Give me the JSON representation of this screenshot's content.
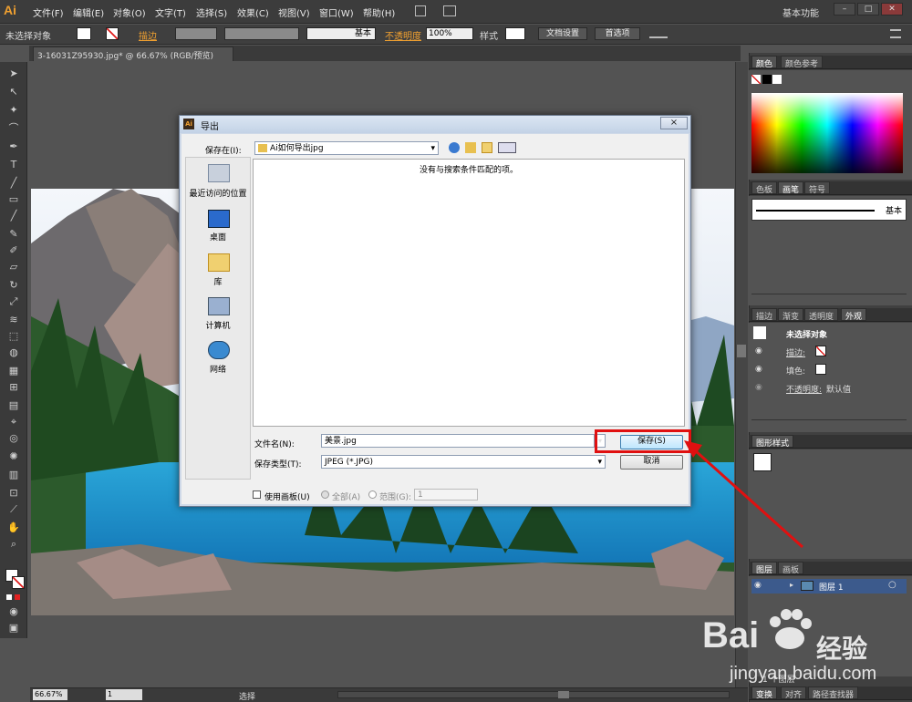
{
  "app": {
    "logo": "Ai",
    "workspace": "基本功能"
  },
  "menus": [
    "文件(F)",
    "编辑(E)",
    "对象(O)",
    "文字(T)",
    "选择(S)",
    "效果(C)",
    "视图(V)",
    "窗口(W)",
    "帮助(H)"
  ],
  "window_buttons": {
    "minimize": "–",
    "restore": "□",
    "close": "✕"
  },
  "control_bar": {
    "selection": "未选择对象",
    "stroke_label": "描边",
    "brush_label": "基本",
    "opacity_label": "不透明度",
    "opacity_value": "100%",
    "style_label": "样式",
    "doc_settings": "文档设置",
    "preferences": "首选项"
  },
  "document_tab": {
    "title": "3-16031Z95930.jpg* @ 66.67% (RGB/预览)",
    "close": "×"
  },
  "status_bar": {
    "zoom": "66.67%",
    "page": "1",
    "mode": "选择"
  },
  "panels": {
    "color_tabs": [
      "颜色",
      "颜色参考"
    ],
    "swatch_tabs": [
      "色板",
      "画笔",
      "符号"
    ],
    "brush_name": "基本",
    "appearance_tabs": [
      "描边",
      "渐变",
      "透明度",
      "外观"
    ],
    "appearance_title": "未选择对象",
    "appearance_stroke": "描边:",
    "appearance_fill": "填色:",
    "appearance_opacity": "不透明度:",
    "appearance_opacity_value": "默认值",
    "graphic_styles_tab": "图形样式",
    "layer_tabs": [
      "图层",
      "画板"
    ],
    "layer_name": "图层 1",
    "layer_count": "1 个图层",
    "bottom_tabs": [
      "变换",
      "对齐",
      "路径查找器"
    ]
  },
  "dialog": {
    "title": "导出",
    "save_in_label": "保存在(I):",
    "save_in_value": "Ai如何导出jpg",
    "empty_message": "没有与搜索条件匹配的项。",
    "places": [
      "最近访问的位置",
      "桌面",
      "库",
      "计算机",
      "网络"
    ],
    "filename_label": "文件名(N):",
    "filename_value": "美景.jpg",
    "filetype_label": "保存类型(T):",
    "filetype_value": "JPEG (*.JPG)",
    "save_button": "保存(S)",
    "cancel_button": "取消",
    "use_artboards": "使用画板(U)",
    "all_label": "全部(A)",
    "range_label": "范围(G):",
    "range_value": "1",
    "close_button": "×"
  },
  "watermark": {
    "brand": "Bai",
    "brand_suffix": "经验",
    "url": "jingyan.baidu.com"
  },
  "colors": {
    "accent_orange": "#f0a030",
    "highlight_red": "#e01010"
  }
}
